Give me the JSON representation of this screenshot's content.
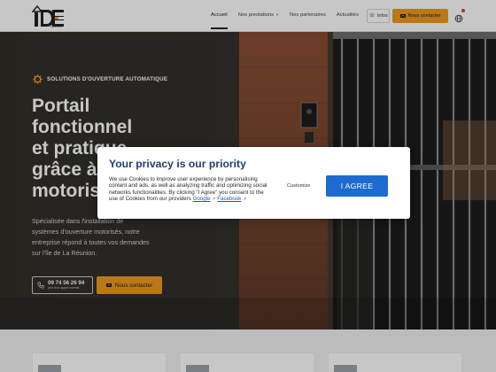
{
  "header": {
    "logo_text": "IDE",
    "logo_sub": "services",
    "nav": [
      {
        "label": "Accueil",
        "active": true,
        "dropdown": false
      },
      {
        "label": "Nos prestations",
        "active": false,
        "dropdown": true
      },
      {
        "label": "Nos partenaires",
        "active": false,
        "dropdown": false
      },
      {
        "label": "Actualités",
        "active": false,
        "dropdown": false
      }
    ],
    "infos_label": "Infos",
    "contact_label": "Nous contacter",
    "lang_icon": "globe-icon"
  },
  "hero": {
    "tag": "SOLUTIONS D'OUVERTURE AUTOMATIQUE",
    "title_lines": [
      "Portail",
      "fonctionnel",
      "et pratique",
      "grâce à la",
      "motorisation"
    ],
    "desc_lines": [
      "Spécialisée dans l'installation de",
      "systèmes d'ouverture motorisés, notre",
      "entreprise répond à toutes vos demandes",
      "sur l'île de La Réunion."
    ],
    "phone_number": "09 74 56 26 94",
    "phone_sub": "prix d'un appel normal",
    "contact_label": "Nous contacter"
  },
  "modal": {
    "title": "Your privacy is our priority",
    "text": "We use Cookies to improve user experience by personalising content and ads, as well as analyzing traffic and optimizing social networks functionalities. By clicking \"I Agree\" you consent to the use of Cookies from our providers",
    "link_google": "Google",
    "link_facebook": "Facebook",
    "customize_label": "Customize",
    "agree_label": "I AGREE"
  },
  "colors": {
    "accent": "#ef9a1f",
    "modal_title": "#1f3f6f",
    "agree_button": "#1d6bd1",
    "hero_dark": "#2a2724"
  }
}
